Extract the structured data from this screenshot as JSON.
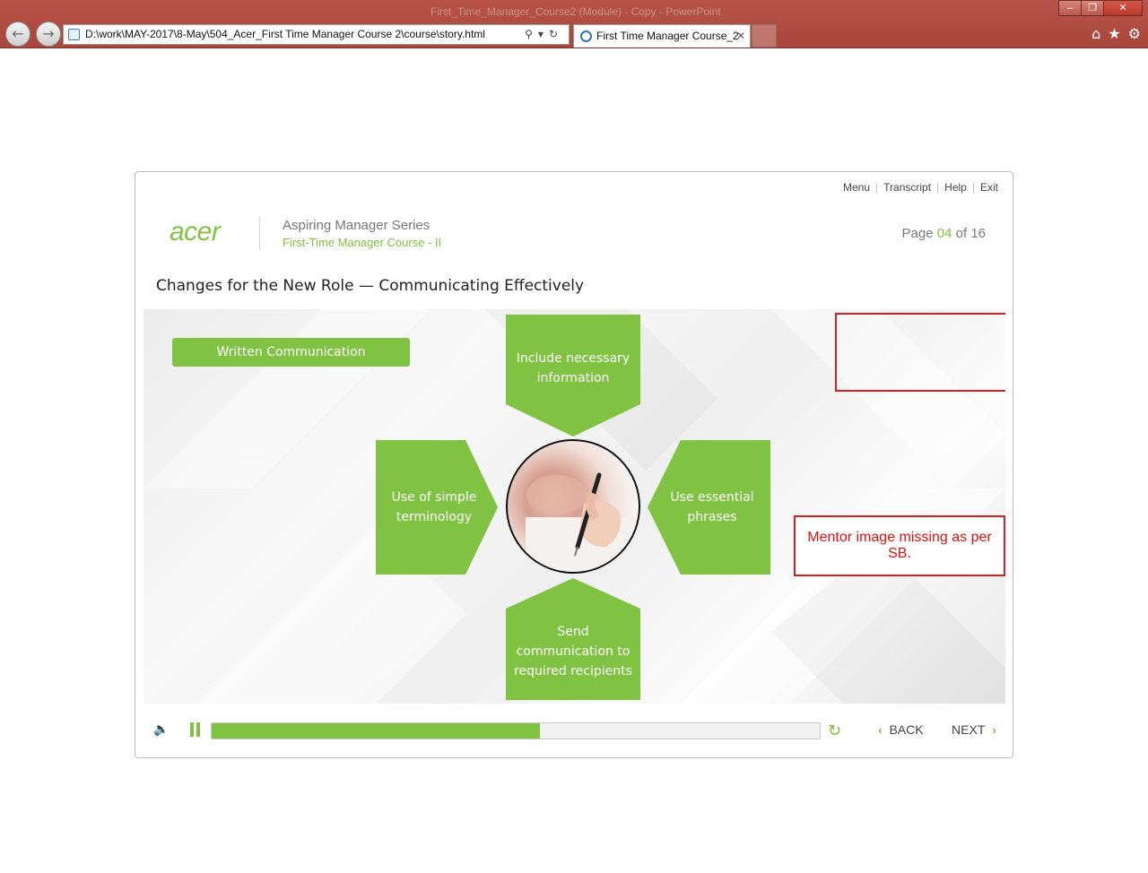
{
  "browser": {
    "window_title": "First_Time_Manager_Course2 (Module) - Copy - PowerPoint",
    "address": "D:\\work\\MAY-2017\\8-May\\504_Acer_First Time Manager Course 2\\course\\story.html",
    "tab_title": "First Time Manager Course_2",
    "tab_close": "✕",
    "window_buttons": [
      "–",
      "❐",
      "✕"
    ]
  },
  "topnav": {
    "menu": "Menu",
    "transcript": "Transcript",
    "help": "Help",
    "exit": "Exit"
  },
  "header": {
    "logo_text": "acer",
    "series": "Aspiring Manager Series",
    "course": "First-Time Manager Course - II",
    "page_prefix": "Page",
    "page_current": "04",
    "page_of": "of",
    "page_total": "16"
  },
  "slide": {
    "title": "Changes for the New Role — Communicating Effectively",
    "pill_label": "Written Communication",
    "arrows": {
      "top": "Include necessary information",
      "left": "Use of simple terminology",
      "right": "Use essential phrases",
      "bottom": "Send communication to required recipients"
    },
    "review_note": "Mentor image missing as per SB."
  },
  "controls": {
    "back_label": "BACK",
    "next_label": "NEXT",
    "progress_fraction": 0.54
  },
  "colors": {
    "accent": "#80c242",
    "review_red": "#d42020"
  }
}
